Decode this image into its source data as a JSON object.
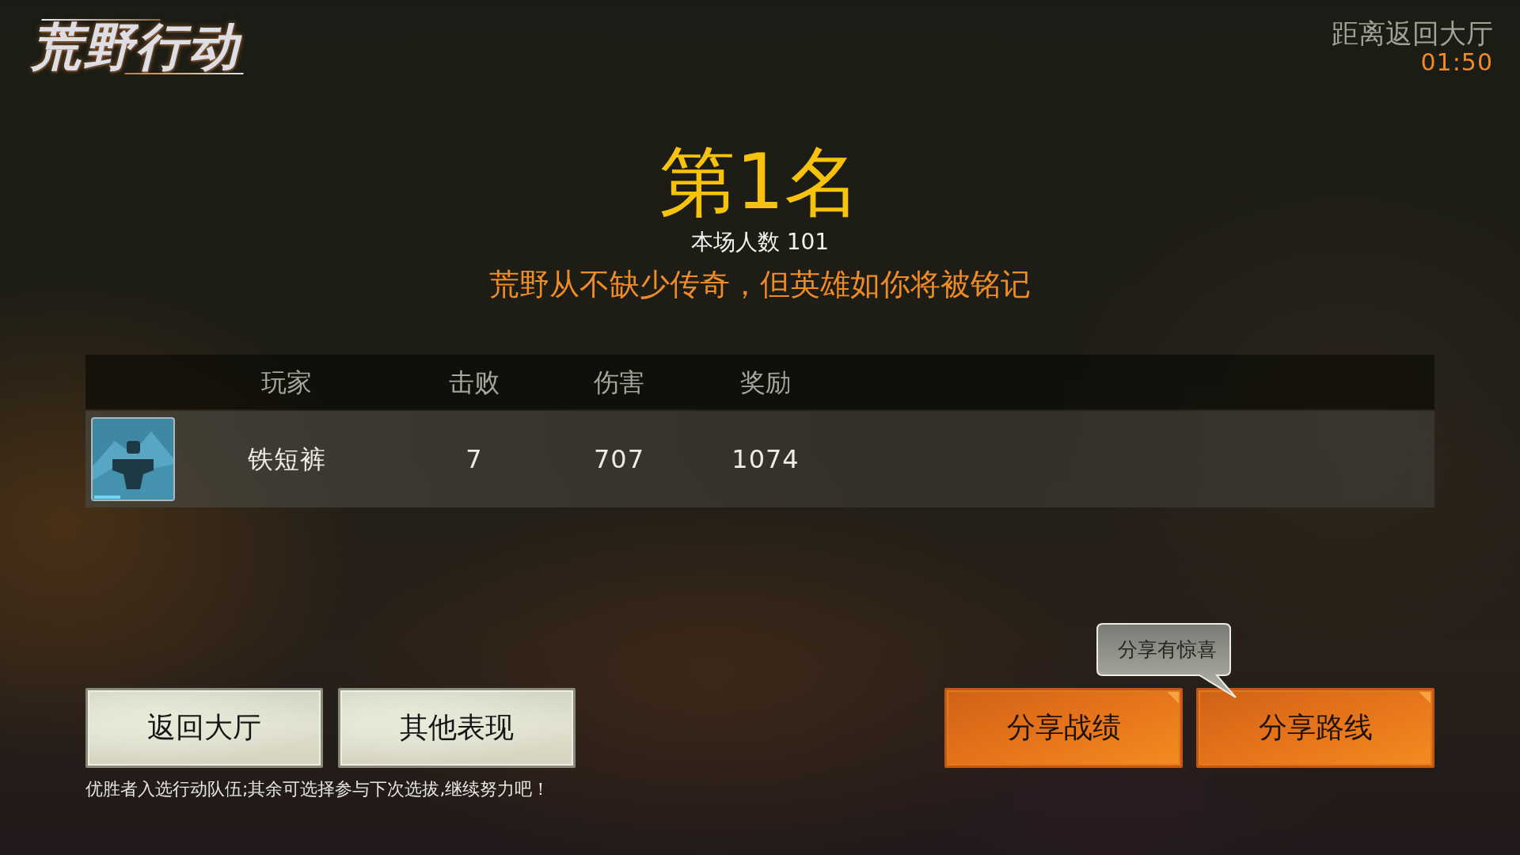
{
  "logo": {
    "text": "荒野行动"
  },
  "countdown": {
    "label": "距离返回大厅",
    "time": "01:50"
  },
  "result": {
    "rank": "第1名",
    "players": "本场人数 101",
    "motto": "荒野从不缺少传奇，但英雄如你将被铭记"
  },
  "table": {
    "columns": [
      "玩家",
      "击败",
      "伤害",
      "奖励"
    ],
    "rows": [
      {
        "cells": [
          "铁短裤",
          "7",
          "707",
          "1074"
        ]
      }
    ]
  },
  "buttons": [
    {
      "label": "返回大厅"
    },
    {
      "label": "其他表现"
    }
  ],
  "note": "优胜者入选行动队伍;其余可选择参与下次选拔,继续努力吧！",
  "share_buttons": [
    {
      "label": "分享战绩"
    },
    {
      "label": "分享路线"
    }
  ],
  "tooltip": {
    "text": "分享有惊喜"
  }
}
